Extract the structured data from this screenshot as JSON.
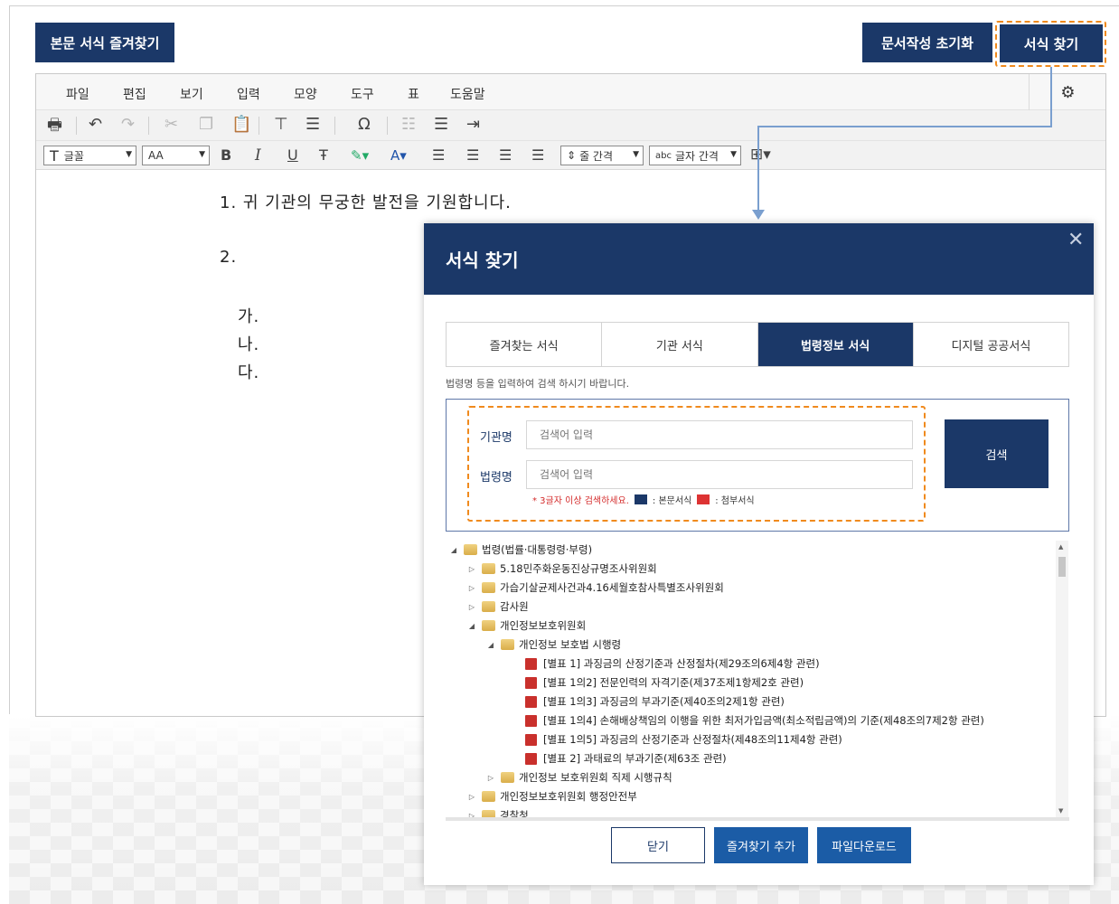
{
  "top_buttons": {
    "favorites": "본문 서식 즐겨찾기",
    "reset": "문서작성 초기화",
    "find_form": "서식 찾기"
  },
  "menu": [
    "파일",
    "편집",
    "보기",
    "입력",
    "모양",
    "도구",
    "표",
    "도움말"
  ],
  "toolbar": {
    "font": "글꼴",
    "size": "AA",
    "line_spacing": "줄 간격",
    "char_spacing": "글자 간격"
  },
  "document": {
    "line1": "1. 귀 기관의 무궁한 발전을 기원합니다.",
    "line2": "2.",
    "item_a": "가.",
    "item_b": "나.",
    "item_c": "다."
  },
  "dialog": {
    "title": "서식 찾기",
    "tabs": [
      "즐겨찾는 서식",
      "기관 서식",
      "법령정보 서식",
      "디지털 공공서식"
    ],
    "active_tab": "법령정보 서식",
    "hint": "법령명 등을 입력하여 검색 하시기 바랍니다.",
    "agency_label": "기관명",
    "law_label": "법령명",
    "agency_placeholder": "검색어 입력",
    "law_placeholder": "검색어 입력",
    "search_button": "검색",
    "note_required": "* 3글자 이상 검색하세요.",
    "note_body": ": 본문서식",
    "note_attach": ": 첨부서식",
    "tree": [
      "법령(법률·대통령령·부령)",
      "5.18민주화운동진상규명조사위원회",
      "가습기살균제사건과4.16세월호참사특별조사위원회",
      "감사원",
      "개인정보보호위원회",
      "개인정보 보호법 시행령",
      "[별표 1] 과징금의 산정기준과 산정절차(제29조의6제4항 관련)",
      "[별표 1의2] 전문인력의 자격기준(제37조제1항제2호 관련)",
      "[별표 1의3] 과징금의 부과기준(제40조의2제1항 관련)",
      "[별표 1의4] 손해배상책임의 이행을 위한 최저가입금액(최소적립금액)의 기준(제48조의7제2항 관련)",
      "[별표 1의5] 과징금의 산정기준과 산정절차(제48조의11제4항 관련)",
      "[별표 2] 과태료의 부과기준(제63조 관련)",
      "개인정보 보호위원회 직제 시행규칙",
      "개인정보보호위원회 행정안전부",
      "경찰청"
    ],
    "close_button": "닫기",
    "add_fav_button": "즐겨찾기 추가",
    "download_button": "파일다운로드"
  }
}
